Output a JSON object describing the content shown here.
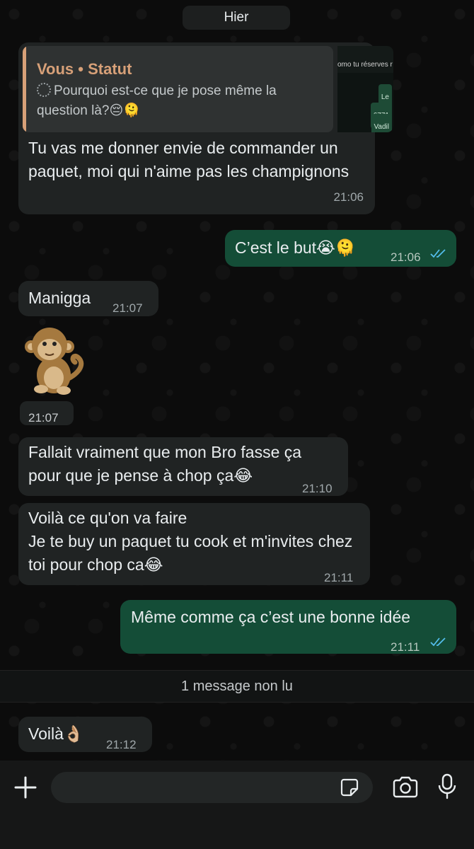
{
  "header": {
    "day_label": "Hier"
  },
  "messages": [
    {
      "direction": "in",
      "reply": {
        "author": "Vous • Statut",
        "text": "Pourquoi est-ce que je pose même la question là?😔🫠",
        "thumb_preview_text": "omo tu réserves r",
        "thumb_chip_1": "Le",
        "thumb_chip_2": "6771",
        "thumb_chip_3": "Vadil"
      },
      "text": "Tu vas me donner envie de commander un paquet, moi qui n'aime pas les champignons",
      "time": "21:06"
    },
    {
      "direction": "out",
      "text": "C’est le but😭🫠",
      "time": "21:06",
      "status": "read"
    },
    {
      "direction": "in",
      "text": "Manigga",
      "time": "21:07"
    },
    {
      "direction": "in",
      "sticker": "monkey-sticker",
      "time": "21:07"
    },
    {
      "direction": "in",
      "text": "Fallait vraiment que mon Bro fasse ça pour que je pense à chop ça😂",
      "time": "21:10"
    },
    {
      "direction": "in",
      "text": "Voilà ce qu'on va faire\nJe te buy un paquet tu cook et m'invites chez toi pour chop ca😂",
      "time": "21:11"
    },
    {
      "direction": "out",
      "text": "Même comme ça c’est une bonne idée",
      "time": "21:11",
      "status": "read"
    },
    {
      "direction": "in",
      "text": "Voilà👌🏼",
      "time": "21:12"
    }
  ],
  "unread_divider": "1 message non lu",
  "composer": {
    "placeholder": "",
    "icons": [
      "plus-icon",
      "sticker-icon",
      "camera-icon",
      "microphone-icon"
    ]
  },
  "colors": {
    "incoming_bubble": "#202323",
    "outgoing_bubble": "#144d37",
    "quote_accent": "#d7a078",
    "read_ticks": "#53bdeb"
  }
}
